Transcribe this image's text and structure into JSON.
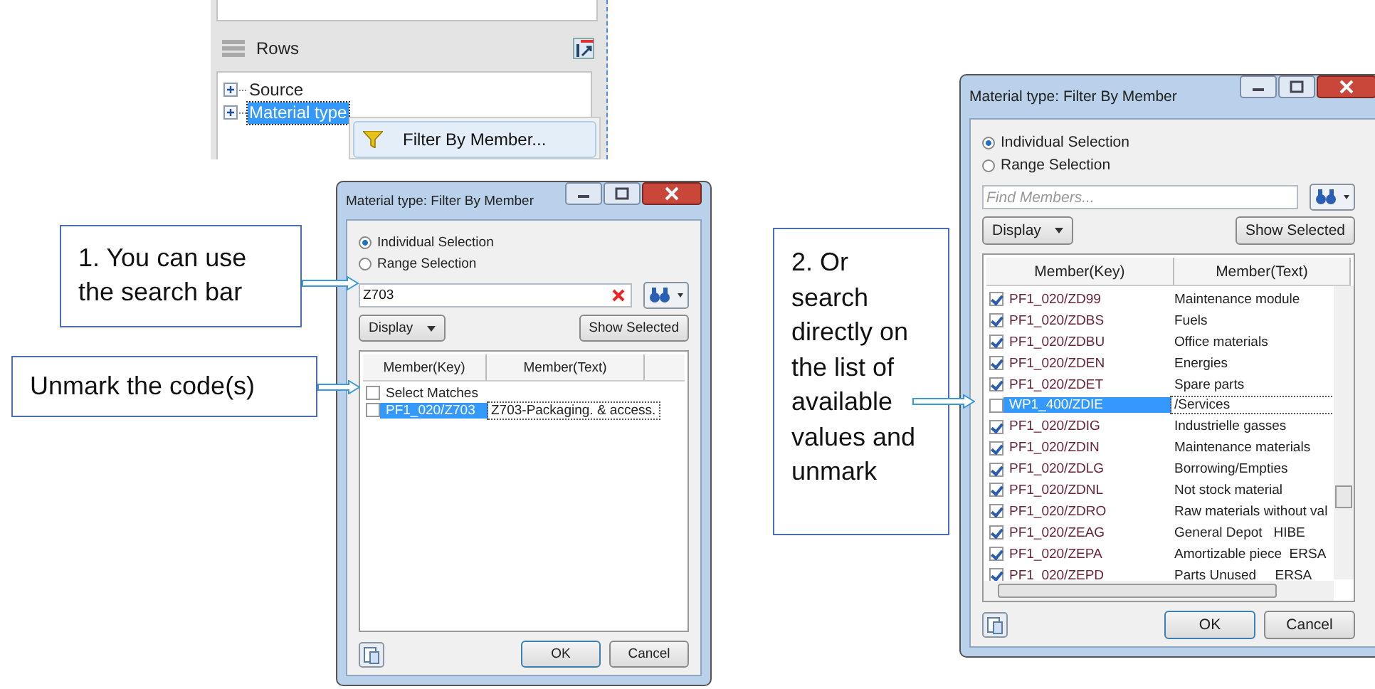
{
  "rows_panel": {
    "title": "Rows",
    "tree": [
      {
        "label": "Source",
        "selected": false
      },
      {
        "label": "Material type",
        "selected": true
      }
    ],
    "context_menu": [
      {
        "label": "Filter By Member...",
        "selected": true
      }
    ]
  },
  "callouts": [
    {
      "text": "1. You can use the search bar"
    },
    {
      "text": "Unmark the code(s)"
    },
    {
      "text": "2. Or search directly on the list of available values and unmark"
    }
  ],
  "dialogs": [
    {
      "title": "Material type: Filter By Member",
      "options": [
        {
          "label": "Individual Selection",
          "selected": true
        },
        {
          "label": "Range Selection",
          "selected": false
        }
      ],
      "search": {
        "value": "Z703"
      },
      "display_button": "Display",
      "show_selected_button": "Show Selected",
      "columns": [
        "Member(Key)",
        "Member(Text)"
      ],
      "select_matches": {
        "label": "Select Matches",
        "checked": false
      },
      "rows": [
        {
          "key": "PF1_020/Z703",
          "text": "Z703-Packaging. & access.",
          "checked": false,
          "selected": true
        }
      ],
      "ok_button": "OK",
      "cancel_button": "Cancel"
    },
    {
      "title": "Material type: Filter By Member",
      "options": [
        {
          "label": "Individual Selection",
          "selected": true
        },
        {
          "label": "Range Selection",
          "selected": false
        }
      ],
      "search": {
        "placeholder": "Find Members..."
      },
      "display_button": "Display",
      "show_selected_button": "Show Selected",
      "columns": [
        "Member(Key)",
        "Member(Text)"
      ],
      "rows": [
        {
          "key": "PF1_020/ZD99",
          "text": "Maintenance module",
          "checked": true,
          "selected": false
        },
        {
          "key": "PF1_020/ZDBS",
          "text": "Fuels",
          "checked": true,
          "selected": false
        },
        {
          "key": "PF1_020/ZDBU",
          "text": "Office materials",
          "checked": true,
          "selected": false
        },
        {
          "key": "PF1_020/ZDEN",
          "text": "Energies",
          "checked": true,
          "selected": false
        },
        {
          "key": "PF1_020/ZDET",
          "text": "Spare parts",
          "checked": true,
          "selected": false
        },
        {
          "key": "WP1_400/ZDIE",
          "text": "/Services",
          "checked": false,
          "selected": true
        },
        {
          "key": "PF1_020/ZDIG",
          "text": "Industrielle gasses",
          "checked": true,
          "selected": false
        },
        {
          "key": "PF1_020/ZDIN",
          "text": "Maintenance materials",
          "checked": true,
          "selected": false
        },
        {
          "key": "PF1_020/ZDLG",
          "text": "Borrowing/Empties",
          "checked": true,
          "selected": false
        },
        {
          "key": "PF1_020/ZDNL",
          "text": "Not stock material",
          "checked": true,
          "selected": false
        },
        {
          "key": "PF1_020/ZDRO",
          "text": "Raw materials without val",
          "checked": true,
          "selected": false
        },
        {
          "key": "PF1_020/ZEAG",
          "text": "General Depot   HIBE",
          "checked": true,
          "selected": false
        },
        {
          "key": "PF1_020/ZEPA",
          "text": "Amortizable piece  ERSA",
          "checked": true,
          "selected": false
        },
        {
          "key": "PF1_020/ZEPD",
          "text": "Parts Unused     ERSA",
          "checked": true,
          "selected": false
        }
      ],
      "ok_button": "OK",
      "cancel_button": "Cancel"
    }
  ]
}
